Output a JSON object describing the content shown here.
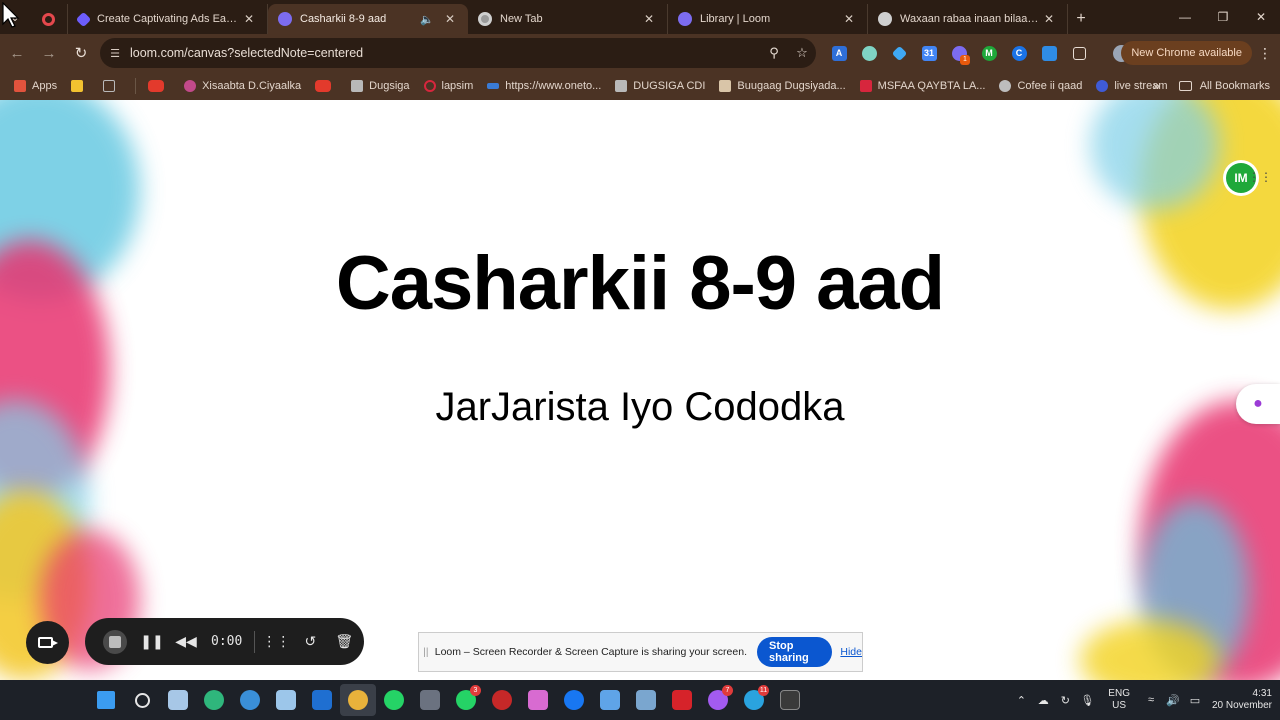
{
  "browser": {
    "tabs": [
      {
        "title": "",
        "favicon_color": "#e5484d",
        "active": false
      },
      {
        "title": "Create Captivating Ads Easily | I",
        "favicon_color": "#6d5dfc",
        "active": false
      },
      {
        "title": "Casharkii 8-9 aad",
        "favicon_color": "#7c6cf0",
        "active": true,
        "audio": true
      },
      {
        "title": "New Tab",
        "favicon_color": "#9a9a9a",
        "active": false
      },
      {
        "title": "Library | Loom",
        "favicon_color": "#7c6cf0",
        "active": false
      },
      {
        "title": "Waxaan rabaa inaan bilaabo Ga",
        "favicon_color": "#cfcfcf",
        "active": false
      }
    ],
    "url": "loom.com/canvas?selectedNote=centered",
    "new_chrome_label": "New Chrome available",
    "extension_badge": "1",
    "bookmarks": [
      {
        "label": "Apps",
        "color": "#e1533d"
      },
      {
        "label": "",
        "color": "#f2c230"
      },
      {
        "label": "",
        "color": "#8c8c8c"
      },
      {
        "label": "",
        "color": "#e33a2c"
      },
      {
        "label": "Xisaabta D.Ciyaalka",
        "color": "#c24a8a"
      },
      {
        "label": "",
        "color": "#e33a2c"
      },
      {
        "label": "Dugsiga",
        "color": "#b9b9b9"
      },
      {
        "label": "lapsim",
        "color": "#d7263d"
      },
      {
        "label": "https://www.oneto...",
        "color": "#3a7bd5"
      },
      {
        "label": "DUGSIGA CDI",
        "color": "#b9b9b9"
      },
      {
        "label": "Buugaag Dugsiyada...",
        "color": "#d9c5a8"
      },
      {
        "label": "MSFAA QAYBTA LA...",
        "color": "#d7263d"
      },
      {
        "label": "Cofee ii qaad",
        "color": "#bdbdbd"
      },
      {
        "label": "live stream",
        "color": "#3f5bd6"
      }
    ],
    "all_bookmarks_label": "All Bookmarks"
  },
  "canvas": {
    "title": "Casharkii 8-9 aad",
    "subtitle": "JarJarista Iyo Cododka",
    "avatar_initials": "IM"
  },
  "recorder": {
    "time": "0:00"
  },
  "share_banner": {
    "message": "Loom – Screen Recorder & Screen Capture is sharing your screen.",
    "stop_label": "Stop sharing",
    "hide_label": "Hide"
  },
  "taskbar": {
    "lang_line1": "ENG",
    "lang_line2": "US",
    "time": "4:31",
    "date": "20 November",
    "badges": {
      "whatsapp": "3",
      "messenger": "7",
      "telegram": "11"
    }
  },
  "colors": {
    "tabstrip": "#2b1d14",
    "toolbar": "#4b3324",
    "loom_blue": "#0b57d0",
    "avatar_green": "#1fa83a"
  }
}
